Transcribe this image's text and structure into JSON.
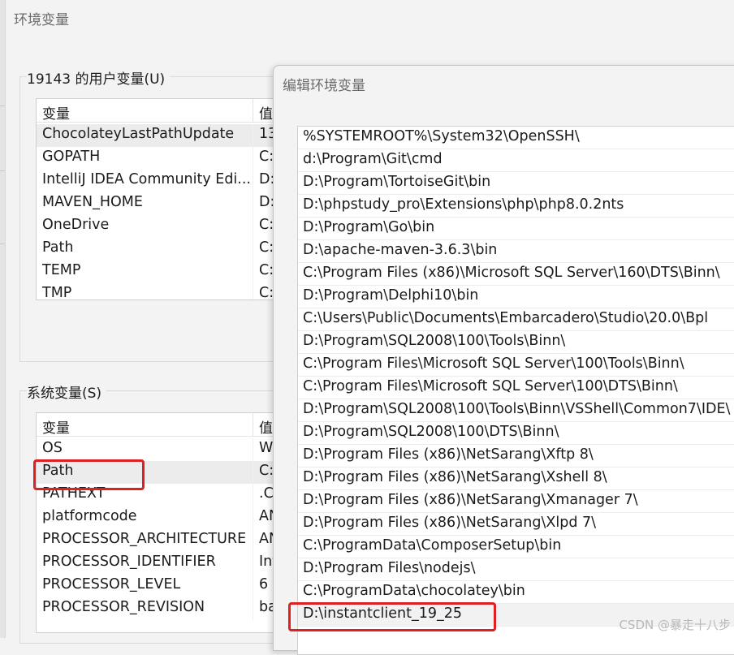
{
  "window": {
    "title": "环境变量"
  },
  "user_vars": {
    "group_label": "19143 的用户变量(U)",
    "col_name": "变量",
    "col_value": "值",
    "rows": [
      {
        "name": "ChocolateyLastPathUpdate",
        "value": "13"
      },
      {
        "name": "GOPATH",
        "value": "C:"
      },
      {
        "name": "IntelliJ IDEA Community Edi...",
        "value": "D:"
      },
      {
        "name": "MAVEN_HOME",
        "value": "D:"
      },
      {
        "name": "OneDrive",
        "value": "C:"
      },
      {
        "name": "Path",
        "value": "C:"
      },
      {
        "name": "TEMP",
        "value": "C:"
      },
      {
        "name": "TMP",
        "value": "C:"
      }
    ]
  },
  "system_vars": {
    "group_label": "系统变量(S)",
    "col_name": "变量",
    "col_value": "值",
    "rows": [
      {
        "name": "OS",
        "value": "W"
      },
      {
        "name": "Path",
        "value": "C:"
      },
      {
        "name": "PATHEXT",
        "value": ".C"
      },
      {
        "name": "platformcode",
        "value": "AN"
      },
      {
        "name": "PROCESSOR_ARCHITECTURE",
        "value": "AN"
      },
      {
        "name": "PROCESSOR_IDENTIFIER",
        "value": "Int"
      },
      {
        "name": "PROCESSOR_LEVEL",
        "value": "6"
      },
      {
        "name": "PROCESSOR_REVISION",
        "value": "ba"
      }
    ]
  },
  "edit_dialog": {
    "title": "编辑环境变量",
    "paths": [
      "%SYSTEMROOT%\\System32\\OpenSSH\\",
      "d:\\Program\\Git\\cmd",
      "D:\\Program\\TortoiseGit\\bin",
      "D:\\phpstudy_pro\\Extensions\\php\\php8.0.2nts",
      "D:\\Program\\Go\\bin",
      "D:\\apache-maven-3.6.3\\bin",
      "C:\\Program Files (x86)\\Microsoft SQL Server\\160\\DTS\\Binn\\",
      "D:\\Program\\Delphi10\\bin",
      "C:\\Users\\Public\\Documents\\Embarcadero\\Studio\\20.0\\Bpl",
      "D:\\Program\\SQL2008\\100\\Tools\\Binn\\",
      "C:\\Program Files\\Microsoft SQL Server\\100\\Tools\\Binn\\",
      "C:\\Program Files\\Microsoft SQL Server\\100\\DTS\\Binn\\",
      "D:\\Program\\SQL2008\\100\\Tools\\Binn\\VSShell\\Common7\\IDE\\",
      "D:\\Program\\SQL2008\\100\\DTS\\Binn\\",
      "D:\\Program Files (x86)\\NetSarang\\Xftp 8\\",
      "D:\\Program Files (x86)\\NetSarang\\Xshell 8\\",
      "D:\\Program Files (x86)\\NetSarang\\Xmanager 7\\",
      "D:\\Program Files (x86)\\NetSarang\\Xlpd 7\\",
      "C:\\ProgramData\\ComposerSetup\\bin",
      "D:\\Program Files\\nodejs\\",
      "C:\\ProgramData\\chocolatey\\bin",
      "D:\\instantclient_19_25"
    ]
  },
  "watermark": "CSDN @暴走十八步",
  "colors": {
    "highlight": "#e02020",
    "selected_row": "#ececec"
  }
}
